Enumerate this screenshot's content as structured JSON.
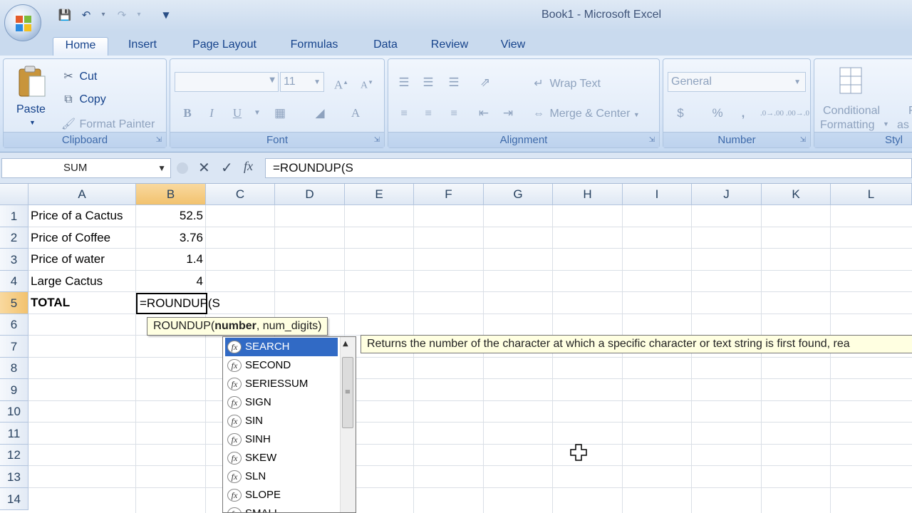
{
  "window": {
    "title": "Book1 - Microsoft Excel"
  },
  "tabs": [
    {
      "label": "Home",
      "active": true
    },
    {
      "label": "Insert"
    },
    {
      "label": "Page Layout"
    },
    {
      "label": "Formulas"
    },
    {
      "label": "Data"
    },
    {
      "label": "Review"
    },
    {
      "label": "View"
    }
  ],
  "ribbon": {
    "clipboard": {
      "paste": "Paste",
      "cut": "Cut",
      "copy": "Copy",
      "format_painter": "Format Painter",
      "label": "Clipboard"
    },
    "font": {
      "font_size": "11",
      "bold": "B",
      "italic": "I",
      "underline": "U",
      "label": "Font"
    },
    "alignment": {
      "wrap_text": "Wrap Text",
      "merge_center": "Merge & Center",
      "label": "Alignment"
    },
    "number": {
      "format": "General",
      "currency": "$",
      "percent": "%",
      "comma": ",",
      "label": "Number"
    },
    "styles": {
      "conditional_line1": "Conditional",
      "conditional_line2": "Formatting",
      "format_as_line1": "Fo",
      "format_as_line2": "as",
      "label": "Styl"
    }
  },
  "formula_bar": {
    "name_box": "SUM",
    "formula": "=ROUNDUP(S",
    "fx": "fx"
  },
  "columns": [
    "A",
    "B",
    "C",
    "D",
    "E",
    "F",
    "G",
    "H",
    "I",
    "J",
    "K",
    "L"
  ],
  "rows": [
    "1",
    "2",
    "3",
    "4",
    "5",
    "6",
    "7",
    "8",
    "9",
    "10",
    "11",
    "12",
    "13",
    "14"
  ],
  "cells": {
    "a1": "Price of a Cactus",
    "b1": "52.5",
    "a2": "Price of Coffee",
    "b2": "3.76",
    "a3": "Price of water",
    "b3": "1.4",
    "a4": "Large Cactus",
    "b4": "4",
    "a5": "TOTAL",
    "b5": "=ROUNDUP(S"
  },
  "hint": {
    "fn": "ROUNDUP(",
    "arg1": "number",
    "rest": ", num_digits)"
  },
  "autocomplete": {
    "items": [
      "SEARCH",
      "SECOND",
      "SERIESSUM",
      "SIGN",
      "SIN",
      "SINH",
      "SKEW",
      "SLN",
      "SLOPE",
      "SMALL"
    ],
    "description": "Returns the number of the character at which a specific character or text string is first found, rea",
    "icon": "fx"
  },
  "colors": {
    "selection": "#316ac5",
    "header_selected": "#f2c26e",
    "tooltip": "#ffffe1"
  }
}
